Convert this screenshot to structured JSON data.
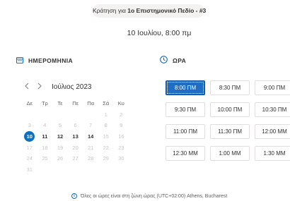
{
  "booking": {
    "prefix": "Κράτηση για ",
    "name": "1o Επιστημονικό Πεδίο - #3"
  },
  "selected_datetime": "10 Ιουλίου, 8:00 πμ",
  "date_section": {
    "label": "ΗΜΕΡΟΜΗΝΙΑ",
    "icon": "calendar-icon"
  },
  "time_section": {
    "label": "ΩΡΑ",
    "icon": "clock-icon"
  },
  "calendar": {
    "month_label": "Ιούλιος 2023",
    "prev_icon": "chevron-left-icon",
    "next_icon": "chevron-right-icon",
    "weekdays": [
      "Δε",
      "Τρ",
      "Τε",
      "Πε",
      "Πα",
      "Σά",
      "Κυ"
    ],
    "weeks": [
      [
        "",
        "",
        "",
        "",
        "",
        "1",
        "2"
      ],
      [
        "3",
        "4",
        "5",
        "6",
        "7",
        "8",
        "9"
      ],
      [
        "10",
        "11",
        "12",
        "13",
        "14",
        "15",
        "16"
      ],
      [
        "17",
        "18",
        "19",
        "20",
        "21",
        "22",
        "23"
      ],
      [
        "24",
        "25",
        "26",
        "27",
        "28",
        "29",
        "30"
      ],
      [
        "31",
        "",
        "",
        "",
        "",
        "",
        ""
      ]
    ],
    "selected_day": "10",
    "available_days": [
      "11",
      "12",
      "13",
      "14"
    ]
  },
  "time_slots": {
    "selected": "8:00 ΠΜ",
    "slots": [
      "8:00 ΠΜ",
      "8:30 ΠΜ",
      "9:00 ΠΜ",
      "9:30 ΠΜ",
      "10:00 ΠΜ",
      "10:30 ΠΜ",
      "11:00 ΠΜ",
      "11:30 ΠΜ",
      "12:00 ΜΜ",
      "12:30 ΜΜ",
      "1:00 ΜΜ",
      "1:30 ΜΜ"
    ]
  },
  "timezone_note": "Όλες οι ώρες είναι στη ζώνη ώρας (UTC+02:00) Athens, Bucharest",
  "colors": {
    "accent": "#106ebe",
    "selected_slot": "#1f6ec3",
    "pill_bg": "#f3f2f1"
  }
}
